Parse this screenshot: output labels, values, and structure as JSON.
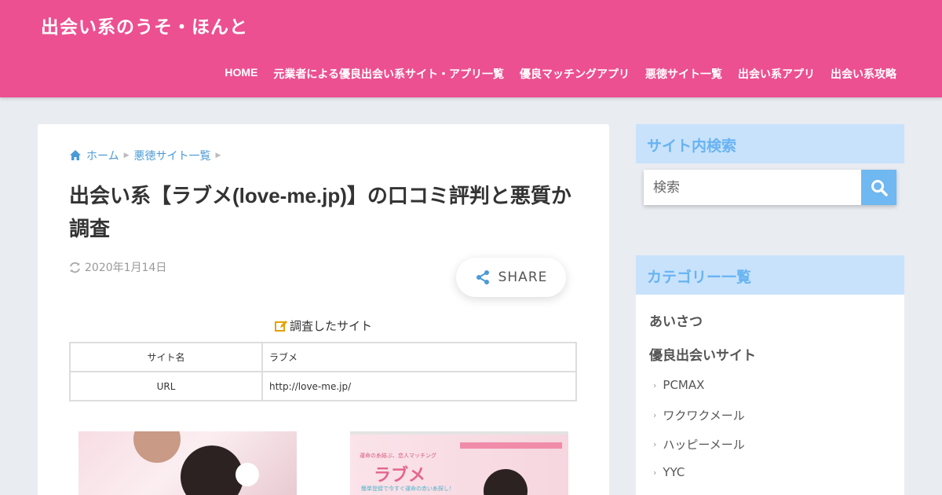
{
  "header": {
    "site_title": "出会い系のうそ・ほんと",
    "nav": [
      "HOME",
      "元業者による優良出会い系サイト・アプリ一覧",
      "優良マッチングアプリ",
      "悪徳サイト一覧",
      "出会い系アプリ",
      "出会い系攻略"
    ]
  },
  "breadcrumb": {
    "home": "ホーム",
    "category": "悪徳サイト一覧"
  },
  "article": {
    "title": "出会い系【ラブメ(love-me.jp)】の口コミ評判と悪質か調査",
    "updated_date": "2020年1月14日",
    "share_label": "SHARE",
    "survey_heading": "調査したサイト",
    "table": [
      {
        "label": "サイト名",
        "value": "ラブメ"
      },
      {
        "label": "URL",
        "value": "http://love-me.jp/"
      }
    ],
    "thumb2": {
      "tagline": "運命の糸結ぶ、恋人マッチング",
      "brand": "ラブメ",
      "sub": "簡単登録で今すぐ運命の赤い糸探し！"
    }
  },
  "sidebar": {
    "search_heading": "サイト内検索",
    "search_placeholder": "検索",
    "category_heading": "カテゴリー一覧",
    "categories": [
      "あいさつ",
      "優良出会いサイト"
    ],
    "subcategories": [
      "PCMAX",
      "ワクワクメール",
      "ハッピーメール",
      "YYC"
    ]
  },
  "colors": {
    "header_bg": "#ec5091",
    "link": "#4b9ad6",
    "widget_head_bg": "#c8e2fc",
    "widget_head_text": "#68b3f2",
    "search_button": "#70b8f1",
    "pen_icon": "#e6a200"
  },
  "icons": [
    "home-icon",
    "refresh-icon",
    "share-icon",
    "edit-icon",
    "search-icon",
    "chevron-right-icon"
  ]
}
